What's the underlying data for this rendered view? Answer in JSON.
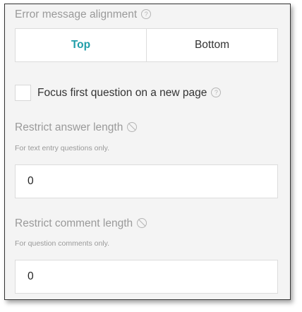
{
  "error_alignment": {
    "label": "Error message alignment",
    "help_icon": "question-circle-icon",
    "options": [
      "Top",
      "Bottom"
    ],
    "selected": "Top"
  },
  "focus_first": {
    "label": "Focus first question on a new page",
    "checked": false,
    "help_icon": "question-circle-icon"
  },
  "restrict_answer": {
    "label": "Restrict answer length",
    "icon": "not-allowed-icon",
    "help": "For text entry questions only.",
    "value": "0"
  },
  "restrict_comment": {
    "label": "Restrict comment length",
    "icon": "not-allowed-icon",
    "help": "For question comments only.",
    "value": "0"
  },
  "colors": {
    "accent": "#1f9da8",
    "panel_bg": "#f4f4f4"
  }
}
